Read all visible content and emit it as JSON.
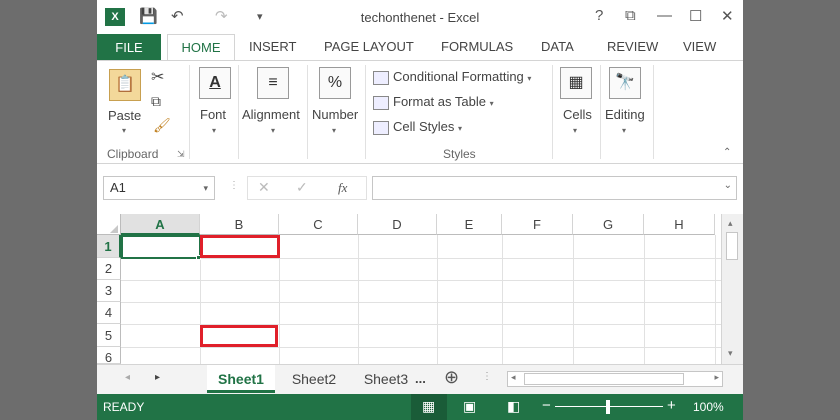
{
  "window": {
    "title": "techonthenet - Excel",
    "help": "?",
    "ribbon_display": "⧉",
    "minimize": "—",
    "maximize": "☐",
    "close": "✕"
  },
  "quick_access": {
    "save": "💾",
    "undo": "↶",
    "redo": "↷",
    "customize": "▾"
  },
  "tabs": [
    "FILE",
    "HOME",
    "INSERT",
    "PAGE LAYOUT",
    "FORMULAS",
    "DATA",
    "REVIEW",
    "VIEW"
  ],
  "ribbon": {
    "clipboard": {
      "paste": "Paste",
      "group_label": "Clipboard"
    },
    "font": "Font",
    "alignment": "Alignment",
    "number": "Number",
    "styles": {
      "conditional": "Conditional Formatting",
      "format_table": "Format as Table",
      "cell_styles": "Cell Styles",
      "group_label": "Styles"
    },
    "cells": "Cells",
    "editing": "Editing"
  },
  "formula_bar": {
    "name_box": "A1",
    "cancel": "✕",
    "enter": "✓",
    "fx": "fx",
    "value": ""
  },
  "columns": [
    "A",
    "B",
    "C",
    "D",
    "E",
    "F",
    "G",
    "H"
  ],
  "rows": [
    "1",
    "2",
    "3",
    "4",
    "5",
    "6"
  ],
  "sheets": {
    "tabs": [
      "Sheet1",
      "Sheet2",
      "Sheet3"
    ],
    "active": "Sheet1",
    "more": "...",
    "add": "⊕"
  },
  "status": {
    "mode": "READY",
    "zoom": "100%",
    "zoom_minus": "−",
    "zoom_plus": "+"
  },
  "colors": {
    "accent": "#217346",
    "highlight": "#e0202a"
  }
}
